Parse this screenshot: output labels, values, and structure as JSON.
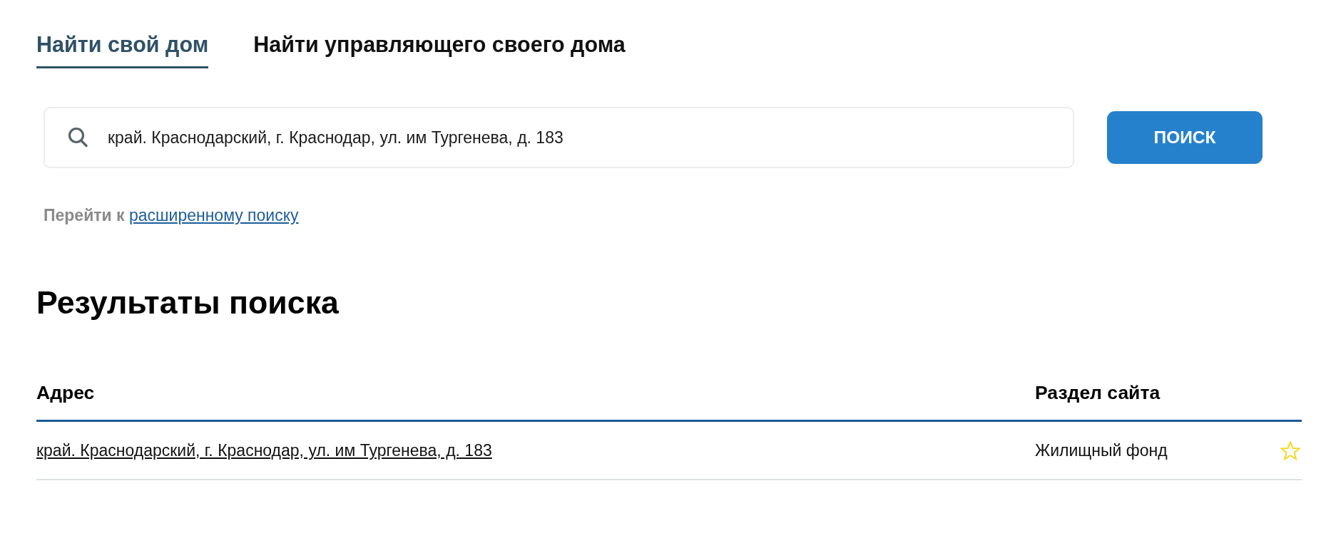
{
  "tabs": [
    {
      "label": "Найти свой дом",
      "selected": true
    },
    {
      "label": "Найти управляющего своего дома",
      "selected": false
    }
  ],
  "search": {
    "value": "край. Краснодарский, г. Краснодар, ул. им Тургенева, д. 183",
    "button": "ПОИСК"
  },
  "advanced": {
    "prefix": "Перейти к",
    "link": "расширенному поиску"
  },
  "results": {
    "title": "Результаты поиска",
    "columns": [
      "Адрес",
      "Раздел сайта"
    ],
    "rows": [
      {
        "address": "край. Краснодарский, г. Краснодар, ул. им Тургенева, д. 183",
        "section": "Жилищный фонд",
        "favorite": false
      }
    ]
  }
}
